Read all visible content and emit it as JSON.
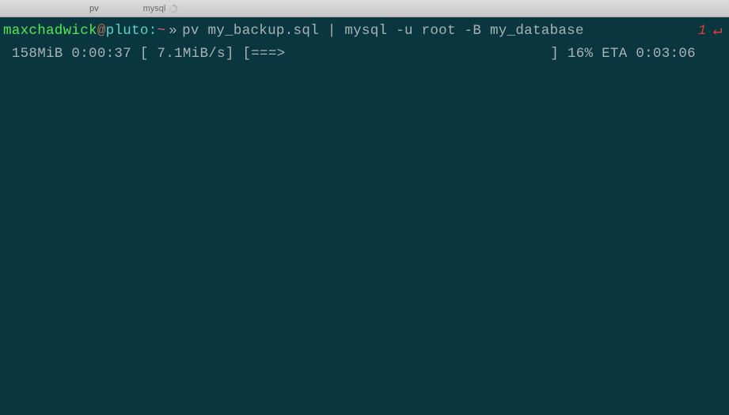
{
  "tabs": {
    "tab1": "pv",
    "tab2": "mysql"
  },
  "prompt": {
    "user": "maxchadwick",
    "at": "@",
    "host": "pluto",
    "colon": ":",
    "tilde": "~",
    "angle": "»",
    "command": "pv my_backup.sql | mysql -u root -B my_database"
  },
  "indicator": {
    "num": "1",
    "arrow": "↵"
  },
  "pv_output": " 158MiB 0:00:37 [ 7.1MiB/s] [===>                               ] 16% ETA 0:03:06"
}
